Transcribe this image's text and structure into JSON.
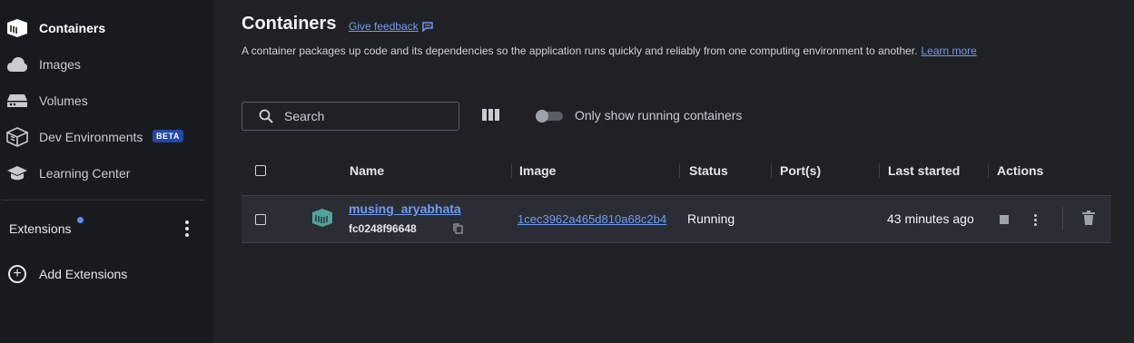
{
  "sidebar": {
    "items": [
      {
        "label": "Containers",
        "icon": "container-icon",
        "active": true
      },
      {
        "label": "Images",
        "icon": "cloud-icon"
      },
      {
        "label": "Volumes",
        "icon": "volume-icon"
      },
      {
        "label": "Dev Environments",
        "icon": "dev-env-icon",
        "badge": "BETA"
      },
      {
        "label": "Learning Center",
        "icon": "graduation-cap-icon"
      }
    ],
    "extensions_label": "Extensions",
    "add_extensions_label": "Add Extensions"
  },
  "header": {
    "title": "Containers",
    "feedback_link": "Give feedback",
    "description": "A container packages up code and its dependencies so the application runs quickly and reliably from one computing environment to another.",
    "learn_more": "Learn more"
  },
  "toolbar": {
    "search_placeholder": "Search",
    "toggle_label": "Only show running containers",
    "toggle_on": false
  },
  "table": {
    "columns": [
      "Name",
      "Image",
      "Status",
      "Port(s)",
      "Last started",
      "Actions"
    ],
    "rows": [
      {
        "name": "musing_aryabhata",
        "id": "fc0248f96648",
        "image": "1cec3962a465d810a68c2b4",
        "status": "Running",
        "ports": "",
        "last_started": "43 minutes ago"
      }
    ]
  },
  "colors": {
    "accent": "#6f9cf5",
    "container_icon": "#4fa398",
    "beta_badge": "#2448a8"
  }
}
